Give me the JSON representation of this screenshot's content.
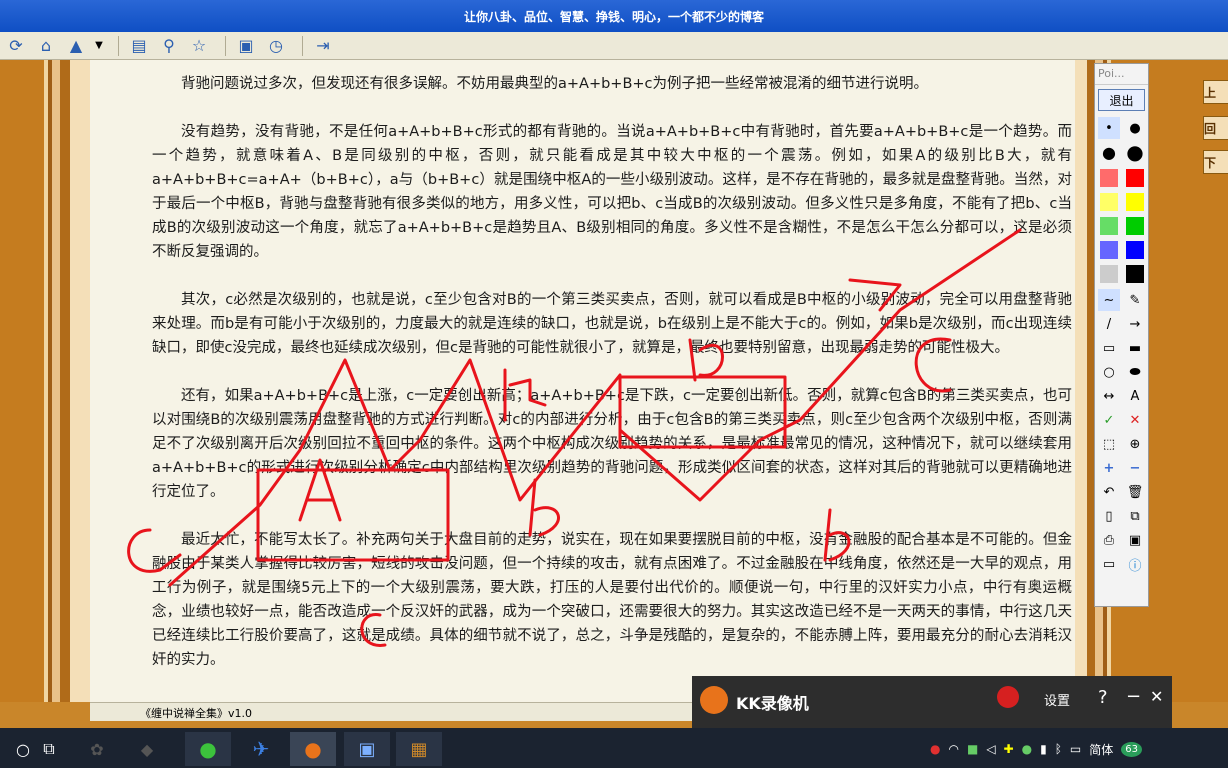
{
  "window": {
    "title": "让你八卦、品位、智慧、挣钱、明心，一个都不少的博客"
  },
  "toolbar": {
    "icons": [
      "refresh-icon",
      "home-icon",
      "tree-icon",
      "chevron-down-icon",
      "panel-icon",
      "search-icon",
      "star-icon",
      "image-icon",
      "history-icon",
      "export-icon"
    ]
  },
  "document": {
    "paragraphs": [
      "背驰问题说过多次，但发现还有很多误解。不妨用最典型的a+A+b+B+c为例子把一些经常被混淆的细节进行说明。",
      "没有趋势，没有背驰，不是任何a+A+b+B+c形式的都有背驰的。当说a+A+b+B+c中有背驰时，首先要a+A+b+B+c是一个趋势。而一个趋势，就意味着A、B是同级别的中枢，否则，就只能看成是其中较大中枢的一个震荡。例如，如果A的级别比B大，就有a+A+b+B+c=a+A+（b+B+c），a与（b+B+c）就是围绕中枢A的一些小级别波动。这样，是不存在背驰的，最多就是盘整背驰。当然，对于最后一个中枢B，背驰与盘整背驰有很多类似的地方，用多义性，可以把b、c当成B的次级别波动。但多义性只是多角度，不能有了把b、c当成B的次级别波动这一个角度，就忘了a+A+b+B+c是趋势且A、B级别相同的角度。多义性不是含糊性，不是怎么干怎么分都可以，这是必须不断反复强调的。",
      "其次，c必然是次级别的，也就是说，c至少包含对B的一个第三类买卖点，否则，就可以看成是B中枢的小级别波动，完全可以用盘整背驰来处理。而b是有可能小于次级别的，力度最大的就是连续的缺口，也就是说，b在级别上是不能大于c的。例如，如果b是次级别，而c出现连续缺口，即使c没完成，最终也延续成次级别，但c是背驰的可能性就很小了，就算是，最终也要特别留意，出现最弱走势的可能性极大。",
      "还有，如果a+A+b+B+c是上涨，c一定要创出新高；a+A+b+B+c是下跌，c一定要创出新低。否则，就算c包含B的第三类买卖点，也可以对围绕B的次级别震荡用盘整背驰的方式进行判断。对c的内部进行分析，由于c包含B的第三类买卖点，则c至少包含两个次级别中枢，否则满足不了次级别离开后次级别回拉不重回中枢的条件。这两个中枢构成次级别趋势的关系，是最标准最常见的情况，这种情况下，就可以继续套用a+A+b+B+c的形式进行次级别分析确定c中内部结构里次级别趋势的背驰问题，形成类似区间套的状态，这样对其后的背驰就可以更精确地进行定位了。",
      "最近太忙，不能写太长了。补充两句关于大盘目前的走势，说实在，现在如果要摆脱目前的中枢，没有金融股的配合基本是不可能的。但金融股由于某类人掌握得比较厉害，短线的攻击没问题，但一个持续的攻击，就有点困难了。不过金融股在中线角度，依然还是一大早的观点，用工行为例子，就是围绕5元上下的一个大级别震荡，要大跌，打压的人是要付出代价的。顺便说一句，中行里的汉奸实力小点，中行有奥运概念，业绩也较好一点，能否改造成一个反汉奸的武器，成为一个突破口，还需要很大的努力。其实这改造已经不是一天两天的事情，中行这几天已经连续比工行股价要高了，这就是成绩。具体的细节就不说了，总之，斗争是残酷的，是复杂的，不能赤膊上阵，要用最充分的耐心去消耗汉奸的实力。"
    ]
  },
  "annotations": {
    "color": "#e8141c",
    "labels": [
      "a",
      "A",
      "1/5",
      "b",
      "B",
      "c",
      "b",
      "c"
    ]
  },
  "nav": {
    "up": "上",
    "back": "回",
    "down": "下"
  },
  "pen_panel": {
    "title": "Poi...",
    "exit_label": "退出",
    "swatches": [
      "#ff6b6b",
      "#ff0000",
      "#ffff66",
      "#ffff00",
      "#66dd66",
      "#00cc00",
      "#6666ff",
      "#0000ff",
      "#cccccc",
      "#000000"
    ],
    "text_tool": "A"
  },
  "statusbar": {
    "text": "《缠中说禅全集》v1.0"
  },
  "recorder": {
    "name": "KK录像机",
    "settings_label": "设置",
    "help": "?",
    "minimize": "−",
    "close": "✕"
  },
  "tray": {
    "language": "简体",
    "badge": "63"
  }
}
